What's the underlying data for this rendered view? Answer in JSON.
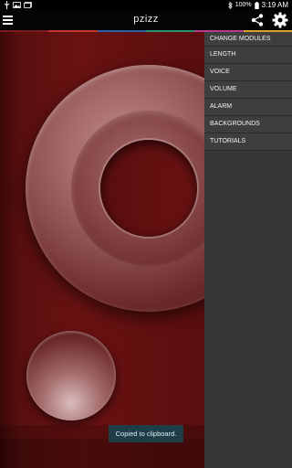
{
  "status_bar": {
    "battery_percent": "100%",
    "time": "3:19 AM"
  },
  "app_bar": {
    "title": "pzizz"
  },
  "accent_colors": [
    "#7a1b1b",
    "#c13a2f",
    "#2b5fa8",
    "#2e8f77",
    "#b33c8c",
    "#d6a12a"
  ],
  "drawer": {
    "items": [
      {
        "label": "CHANGE MODULES"
      },
      {
        "label": "LENGTH"
      },
      {
        "label": "VOICE"
      },
      {
        "label": "VOLUME"
      },
      {
        "label": "ALARM"
      },
      {
        "label": "BACKGROUNDS"
      },
      {
        "label": "TUTORIALS"
      }
    ]
  },
  "toast": {
    "message": "Copied to clipboard."
  }
}
